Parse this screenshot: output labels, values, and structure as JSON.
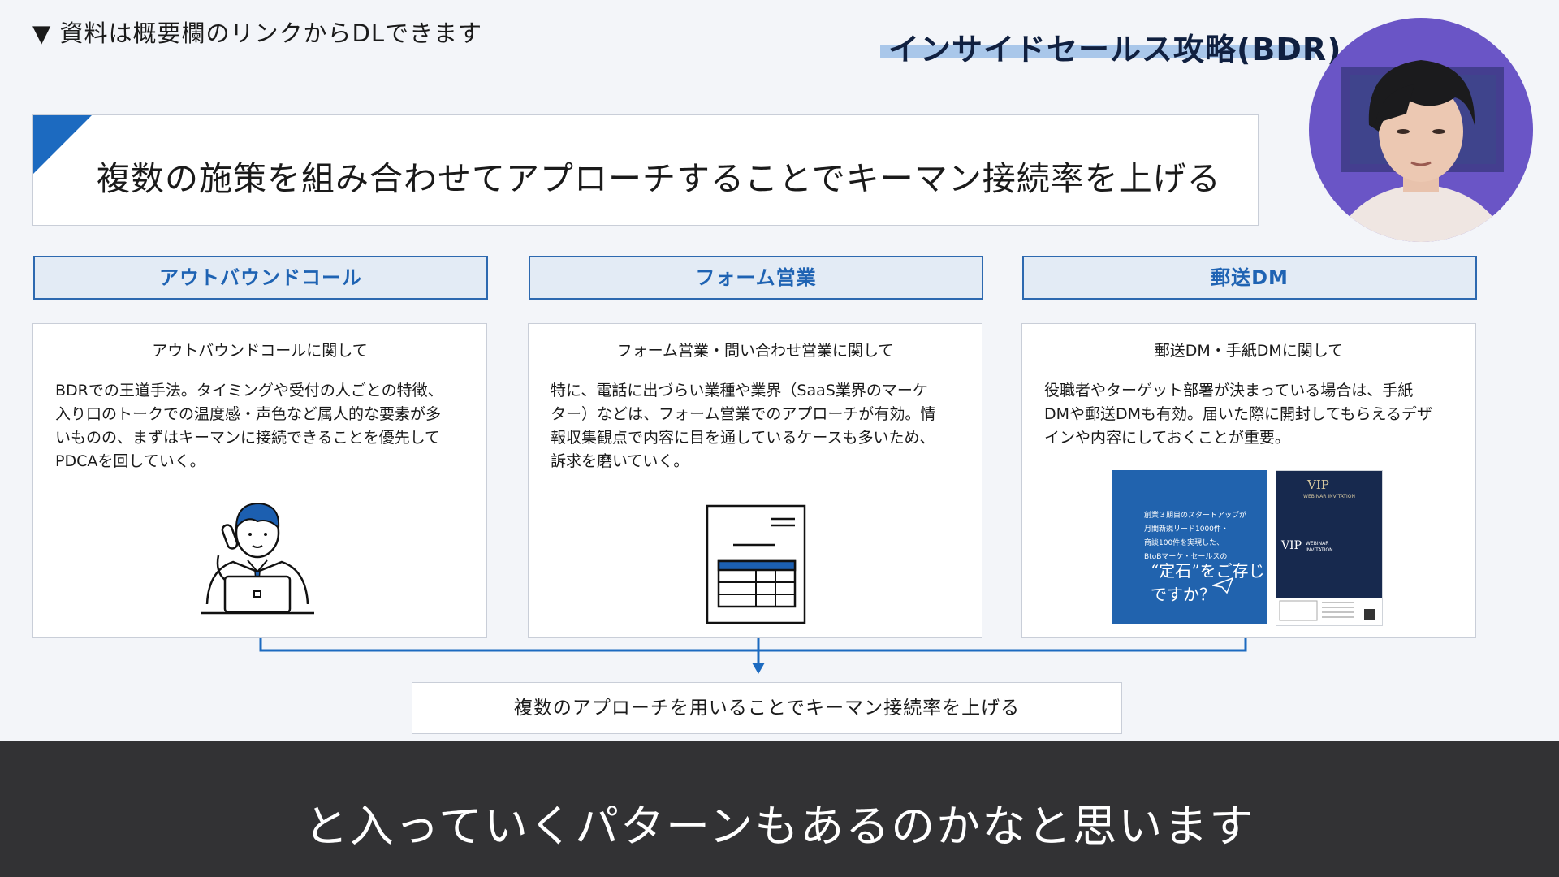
{
  "top_note": "▼ 資料は概要欄のリンクからDLできます",
  "series_title": "インサイドセールス攻略(BDR)",
  "headline": "複数の施策を組み合わせてアプローチすることでキーマン接続率を上げる",
  "columns": [
    {
      "header": "アウトバウンドコール",
      "card_title": "アウトバウンドコールに関して",
      "body": "BDRでの王道手法。タイミングや受付の人ごとの特徴、\n入り口のトークでの温度感・声色など属人的な要素が多\nいものの、まずはキーマンに接続できることを優先して\nPDCAを回していく。",
      "illustration": "person-on-phone-with-laptop-icon"
    },
    {
      "header": "フォーム営業",
      "card_title": "フォーム営業・問い合わせ営業に関して",
      "body": "特に、電話に出づらい業種や業界（SaaS業界のマーケ\nター）などは、フォーム営業でのアプローチが有効。情\n報収集観点で内容に目を通しているケースも多いため、\n訴求を磨いていく。",
      "illustration": "web-form-document-icon"
    },
    {
      "header": "郵送DM",
      "card_title": "郵送DM・手紙DMに関して",
      "body": "役職者やターゲット部署が決まっている場合は、手紙\nDMや郵送DMも有効。届いた際に開封してもらえるデザ\nインや内容にしておくことが重要。",
      "flyer_blue": {
        "text": "創業３期目のスタートアップが\n月間新規リード1000件・\n商談100件を実現した、\nBtoBマーケ・セールスの",
        "big": "“定石”をご存じですか？"
      },
      "flyer_navy": {
        "vip": "VIP",
        "webinar": "WEBINAR INVITATION"
      }
    }
  ],
  "result": "複数のアプローチを用いることでキーマン接続率を上げる",
  "caption": "と入っていくパターンもあるのかなと思います",
  "colors": {
    "accent": "#1c6ac0",
    "header_bg": "#e3ebf5",
    "header_text": "#1f63b3",
    "caption_band": "#323234",
    "avatar_bg": "#6a55c6"
  }
}
